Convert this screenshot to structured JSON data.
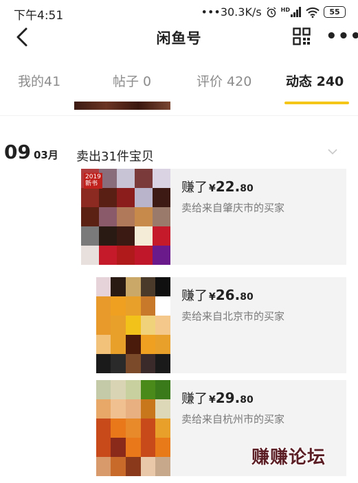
{
  "status_bar": {
    "time": "下午4:51",
    "network_speed": "•••30.3K/s",
    "alarm_icon": "alarm-icon",
    "signal_label": "HD",
    "battery": "55"
  },
  "nav": {
    "title": "闲鱼号",
    "back_icon": "chevron-left-icon",
    "qr_icon": "qr-code-icon",
    "more_icon": "more-dots-icon",
    "more_glyph": "•••"
  },
  "tabs": [
    {
      "label": "我的41",
      "active": false
    },
    {
      "label": "帖子 0",
      "active": false
    },
    {
      "label": "评价 420",
      "active": false
    },
    {
      "label": "动态 240",
      "active": true
    }
  ],
  "accent_color": "#f5c518",
  "feed": {
    "date_day": "09",
    "date_month": "03月",
    "group_title": "卖出31件宝贝",
    "items": [
      {
        "earn_prefix": "赚了",
        "currency": "¥",
        "amount_int": "22.",
        "amount_dec": "80",
        "buyer_text": "卖给来自肇庆市的买家",
        "badge": "2019\n新书"
      },
      {
        "earn_prefix": "赚了",
        "currency": "¥",
        "amount_int": "26.",
        "amount_dec": "80",
        "buyer_text": "卖给来自北京市的买家"
      },
      {
        "earn_prefix": "赚了",
        "currency": "¥",
        "amount_int": "29.",
        "amount_dec": "80",
        "buyer_text": "卖给来自杭州市的买家"
      }
    ]
  },
  "watermark": "赚赚论坛"
}
